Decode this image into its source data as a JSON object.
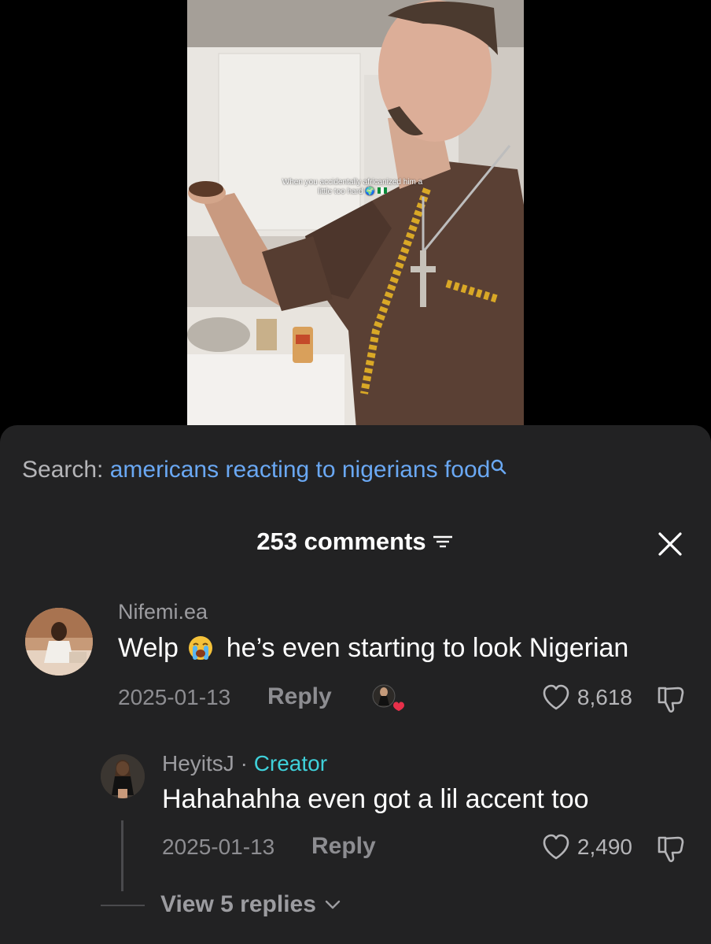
{
  "video": {
    "caption_line1": "When you accidentally africanized him a",
    "caption_line2": "little too hard"
  },
  "search": {
    "prefix": "Search:",
    "query": "americans reacting to nigerians food"
  },
  "comments": {
    "count_label": "253 comments"
  },
  "comment_1": {
    "username": "Nifemi.ea",
    "text_before": "Welp",
    "emoji": "loudly-crying-face",
    "text_after": "he’s even starting to look Nigerian",
    "date": "2025-01-13",
    "reply_label": "Reply",
    "likes": "8,618"
  },
  "comment_2": {
    "username": "HeyitsJ",
    "separator": " · ",
    "creator_label": "Creator",
    "text": "Hahahahha even got a lil accent too",
    "date": "2025-01-13",
    "reply_label": "Reply",
    "likes": "2,490"
  },
  "view_replies": {
    "label": "View 5 replies"
  },
  "colors": {
    "sheet_bg": "#222223",
    "link_blue": "#6aa8f3",
    "creator_teal": "#3fd1da",
    "liked_heart": "#e8304a"
  }
}
